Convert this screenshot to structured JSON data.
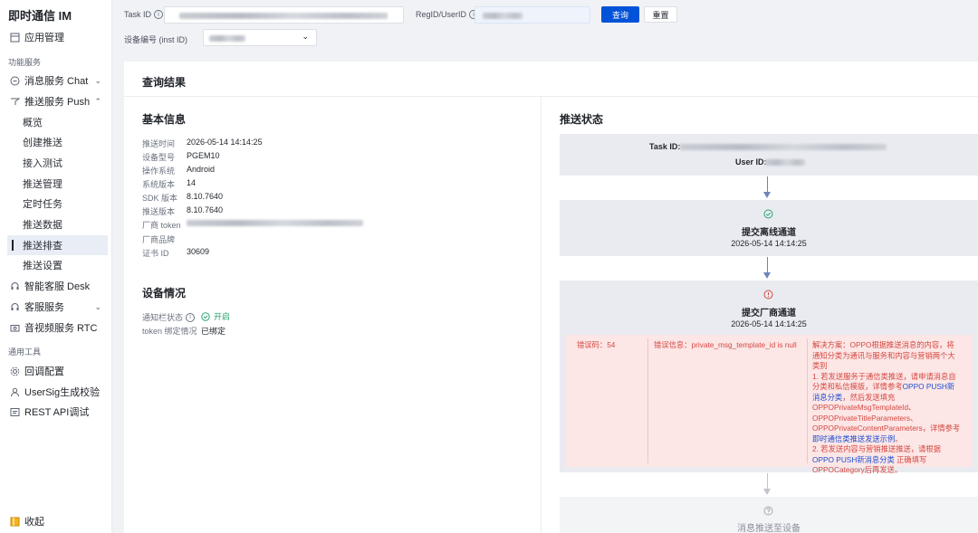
{
  "sidebar": {
    "brand": "即时通信 IM",
    "app_manage": "应用管理",
    "group_function": "功能服务",
    "chat": "消息服务 Chat",
    "push": "推送服务 Push",
    "push_sub": [
      "概览",
      "创建推送",
      "接入测试",
      "推送管理",
      "定时任务",
      "推送数据",
      "推送排查",
      "推送设置"
    ],
    "desk": "智能客服 Desk",
    "kefu": "客服服务",
    "rtc": "音视频服务 RTC",
    "group_tools": "通用工具",
    "callback": "回调配置",
    "usersig": "UserSig生成校验",
    "rest": "REST API调试",
    "collapse": "收起"
  },
  "search": {
    "task_id_label": "Task ID",
    "regid_label": "RegID/UserID",
    "query_button": "查询",
    "reset_button": "重置",
    "device_label": "设备编号 (inst ID)"
  },
  "result": {
    "title": "查询结果",
    "basic_title": "基本信息",
    "basic": [
      {
        "k": "推送时间",
        "v": "2026-05-14 14:14:25"
      },
      {
        "k": "设备型号",
        "v": "PGEM10"
      },
      {
        "k": "操作系统",
        "v": "Android"
      },
      {
        "k": "系统版本",
        "v": "14"
      },
      {
        "k": "SDK 版本",
        "v": "8.10.7640"
      },
      {
        "k": "推送版本",
        "v": "8.10.7640"
      },
      {
        "k": "厂商 token",
        "v": ""
      },
      {
        "k": "厂商品牌",
        "v": ""
      },
      {
        "k": "证书 ID",
        "v": "30609"
      }
    ],
    "device_title": "设备情况",
    "notify_label": "通知栏状态",
    "notify_value": "开启",
    "token_label": "token 绑定情况",
    "token_value": "已绑定"
  },
  "status": {
    "title": "推送状态",
    "task_id_label": "Task ID:",
    "user_id_label": "User ID:",
    "step1_title": "提交离线通道",
    "step1_time": "2026-05-14 14:14:25",
    "step2_title": "提交厂商通道",
    "step2_time": "2026-05-14 14:14:25",
    "step3_title": "消息推送至设备",
    "error_code": "错误码：54",
    "error_info": "错误信息：private_msg_template_id is null",
    "solution_1": "解决方案：OPPO根据推送消息的内容，将通知分类为通讯与服务和内容与营销两个大类别",
    "solution_2a": "1. 若发送服务于通信类推送，请申请消息自分类和私信模版，详情参考",
    "solution_2_link": "OPPO PUSH新消息分类",
    "solution_2b": "，然后发送填充OPPOPrivateMsgTemplateId、OPPOPrivateTitleParameters、OPPOPrivateContentParameters，详情参考",
    "solution_2_link2": "即时通信类推送发送示例",
    "solution_2c": "。",
    "solution_3a": "2. 若发送内容与营销推送推送，请根据",
    "solution_3_link": "OPPO PUSH新消息分类",
    "solution_3b": " 正确填写OPPOCategory后再发送。"
  },
  "colors": {
    "primary": "#0052d9",
    "success": "#2ba471",
    "error": "#d54941"
  }
}
